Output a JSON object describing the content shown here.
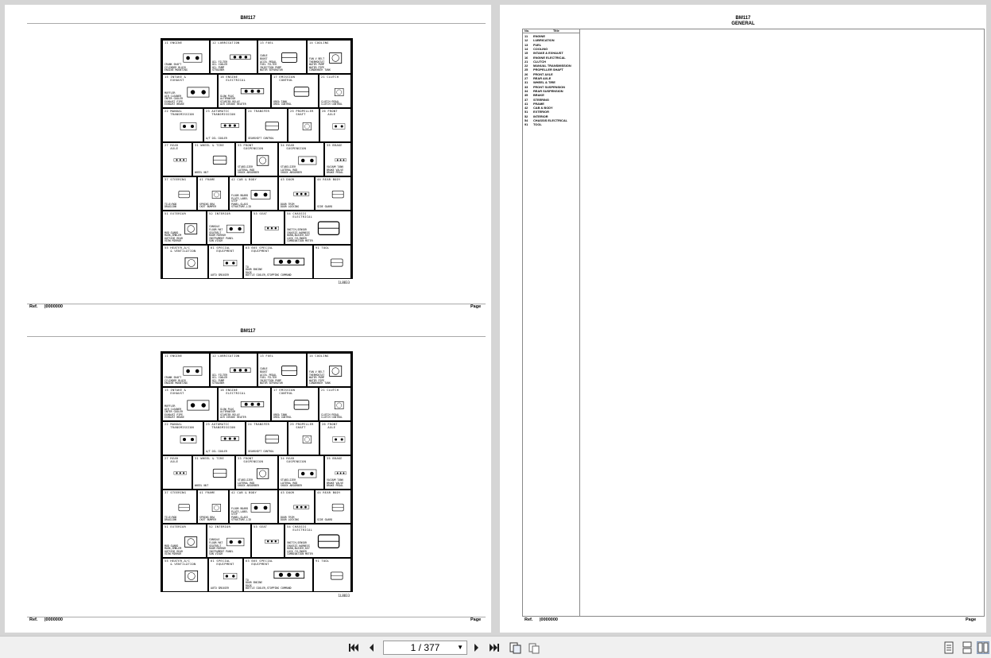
{
  "document": {
    "model": "BM117",
    "ref_label": "Ref.",
    "ref_value": "|0000000",
    "page_label": "Page",
    "figure_code": "1L8833"
  },
  "index_cells": [
    {
      "label": "11 ENGINE",
      "sub": "CRANK SHAFT\nCYLINDER BLOCK\nENGINE MOUNTING"
    },
    {
      "label": "12 LUBRICATION",
      "sub": "OIL FILTER\nOIL COOLER\nOIL PUMP\nSTRAINER"
    },
    {
      "label": "13 FUEL",
      "sub": "CABLE\nBOOST\nACCEL PEDAL\nFUEL FILTER\nINJECTION PUMP\nWATER SEPARATOR"
    },
    {
      "label": "14 COOLING",
      "sub": "FAN V BELT\nTHERMOSTAT\nWATER PUMP\nWATER PIPE\nCONDENSER TANK"
    },
    {
      "label": "15 INTAKE &\n   EXHAUST",
      "sub": "MUFFLER\nAIR CLEANER\nINTER COOLER\nEXHAUST PIPE\nEXHAUST BRAKE"
    },
    {
      "label": "16 ENGINE\n   ELECTRICAL",
      "sub": "GLOW PLUG\nALTERNATOR\nSTARTER RELAY\nAIR INTAKE HEATER"
    },
    {
      "label": "17 EMISSION\n   CONTROL",
      "sub": "UREA TANK\nUREA CONTROL"
    },
    {
      "label": "21 CLUTCH",
      "sub": "CLUTCH PEDAL\nCLUTCH CONTROL"
    },
    {
      "label": "22 MANUAL\n   TRANSMISSION",
      "sub": ""
    },
    {
      "label": "23 AUTOMATIC\n   TRANSMISSION",
      "sub": "A/T OIL COOLER"
    },
    {
      "label": "24 TRANSFER",
      "sub": "GEARSHIFT CONTROL"
    },
    {
      "label": "25 PROPELLER\n   SHAFT",
      "sub": ""
    },
    {
      "label": "26 FRONT\n   AXLE",
      "sub": ""
    },
    {
      "label": "27 REAR\n   AXLE",
      "sub": ""
    },
    {
      "label": "31 WHEEL & TIRE",
      "sub": "WHEEL NUT"
    },
    {
      "label": "33 FRONT\n   SUSPENSION",
      "sub": "STABILIZER\nLATERAL ROD\nSHOCK ABSORBER"
    },
    {
      "label": "34 REAR\n   SUSPENSION",
      "sub": "STABILIZER\nLATERAL ROD\nSHOCK ABSORBER"
    },
    {
      "label": "35 BRAKE",
      "sub": "VACUUM TANK\nBRAKE VALVE\nBRAKE PEDAL"
    },
    {
      "label": "37 STEERING",
      "sub": "TILE/ROD\nDRAGLINK"
    },
    {
      "label": "41 FRAME",
      "sub": "SPRING BRA\nCKET BUMPER"
    },
    {
      "label": "42 CAB & BODY",
      "sub": "FLOOR BOARD\nPLATE,LABEL\nSTEP\nPANEL,GLASS\nSTRUCTURE,LID"
    },
    {
      "label": "43 DOOR",
      "sub": "DOOR TRIM\nDOOR LOCKING"
    },
    {
      "label": "44 REAR BODY",
      "sub": "SIDE GUARD"
    },
    {
      "label": "51 EXTERIOR",
      "sub": "MUD GUARD\nMARK,EMBLEM\nOUTSIDE REAR\nVIEW MIRROR"
    },
    {
      "label": "52 INTERIOR",
      "sub": "CONSOLE\nFLOOR MAT\nSEATBELT\nROOM MIRROR\nINSTRUMENT PANEL\nSUN VISOR"
    },
    {
      "label": "53 SEAT",
      "sub": ""
    },
    {
      "label": "54 CHASSIS\n   ELECTRICAL",
      "sub": "SWITCH,SENSOR\nCHASSIS HARNESS\nHORN,BUZZER,KEY\nLOCK CYLINDER\nCOMBINATION METER"
    },
    {
      "label": "55 HEATER,A/C\n   & VENTILATION",
      "sub": ""
    },
    {
      "label": "61 SPECIAL\n   EQUIPMENT",
      "sub": "AUTO GREASER"
    },
    {
      "label": "63 665 SPECIAL\n   EQUIPMENT",
      "sub": "TO\nDOOR ENGINE\nRACK\nBOTTLE COOLER,STOPPING COMMAND"
    },
    {
      "label": "91 TOOL",
      "sub": ""
    }
  ],
  "general_page": {
    "model": "BM117",
    "title": "GENERAL",
    "col_no": "No.",
    "col_title": "Title",
    "rows": [
      {
        "no": "11",
        "title": "ENGINE"
      },
      {
        "no": "12",
        "title": "LUBRICATION"
      },
      {
        "no": "13",
        "title": "FUEL"
      },
      {
        "no": "14",
        "title": "COOLING"
      },
      {
        "no": "15",
        "title": "INTAKE & EXHAUST"
      },
      {
        "no": "16",
        "title": "ENGINE ELECTRICAL"
      },
      {
        "no": "21",
        "title": "CLUTCH"
      },
      {
        "no": "22",
        "title": "MANUAL TRANSMISSION"
      },
      {
        "no": "25",
        "title": "PROPELLER SHAFT"
      },
      {
        "no": "26",
        "title": "FRONT AXLE"
      },
      {
        "no": "27",
        "title": "REAR AXLE"
      },
      {
        "no": "31",
        "title": "WHEEL & TIRE"
      },
      {
        "no": "33",
        "title": "FRONT SUSPENSION"
      },
      {
        "no": "34",
        "title": "REAR SUSPENSION"
      },
      {
        "no": "35",
        "title": "BRAKE"
      },
      {
        "no": "37",
        "title": "STEERING"
      },
      {
        "no": "41",
        "title": "FRAME"
      },
      {
        "no": "42",
        "title": "CAB & BODY"
      },
      {
        "no": "51",
        "title": "EXTERIOR"
      },
      {
        "no": "52",
        "title": "INTERIOR"
      },
      {
        "no": "54",
        "title": "CHASSIS ELECTRICAL"
      },
      {
        "no": "91",
        "title": "TOOL"
      }
    ],
    "ref_label": "Ref.",
    "ref_value": "|0000000",
    "page_label": "Page"
  },
  "toolbar": {
    "page_indicator": "1 / 377",
    "icons": [
      "first-page-icon",
      "prev-page-icon",
      "next-page-icon",
      "last-page-icon",
      "fit-page-icon",
      "two-page-icon",
      "single-page-view-icon",
      "continuous-view-icon",
      "facing-view-icon"
    ]
  }
}
